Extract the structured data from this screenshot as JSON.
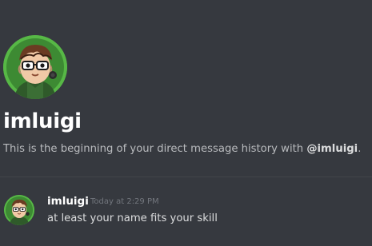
{
  "dm": {
    "username": "imluigi",
    "intro_prefix": "This is the beginning of your direct message history with ",
    "intro_mention": "@imluigi",
    "intro_suffix": "."
  },
  "message": {
    "author": "imluigi",
    "timestamp": "Today at 2:29 PM",
    "text": "at least your name fits your skill"
  },
  "avatar": {
    "icon": "user-avatar-icon",
    "ring_color": "#57b846"
  },
  "colors": {
    "background": "#36393f",
    "username": "#ffffff",
    "muted_text": "#b9bbbe",
    "timestamp": "#72767d",
    "divider": "#42454a"
  }
}
